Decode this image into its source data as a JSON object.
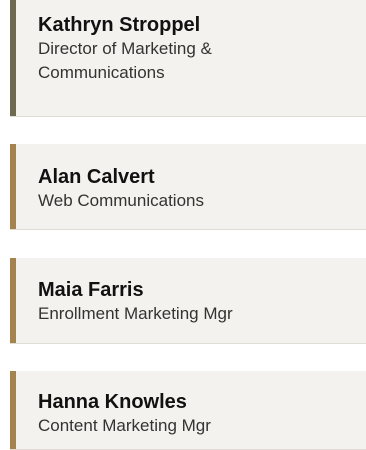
{
  "staff": [
    {
      "name": "Kathryn Stroppel",
      "title_line1": "Director of Marketing &",
      "title_line2": "Communications"
    },
    {
      "name": "Alan Calvert",
      "title_line1": "Web Communications"
    },
    {
      "name": "Maia Farris",
      "title_line1": "Enrollment Marketing Mgr"
    },
    {
      "name": "Hanna Knowles",
      "title_line1": "Content Marketing Mgr"
    }
  ],
  "colors": {
    "card_background": "#f3f2ee",
    "accent_active": "#6e6a52",
    "accent": "#a5834f"
  }
}
